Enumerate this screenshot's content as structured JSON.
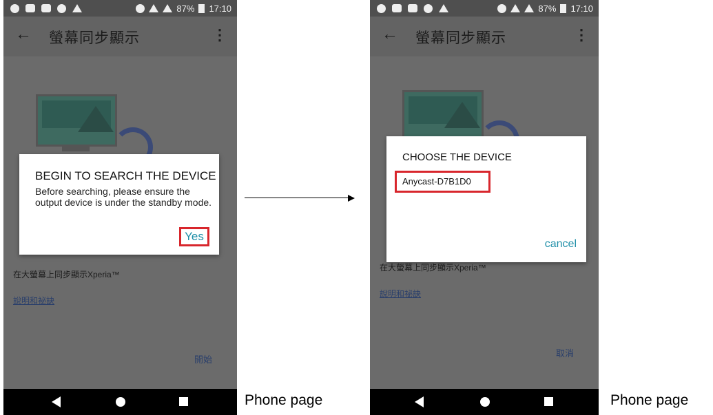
{
  "status_bar": {
    "battery": "87%",
    "time": "17:10"
  },
  "app_bar": {
    "title": "螢幕同步顯示",
    "back_icon": "←",
    "more_icon": "⋮"
  },
  "page": {
    "description": "在大螢幕上同步顯示Xperia™",
    "help_link": "說明和祕訣",
    "start_label": "開始"
  },
  "dialog_search": {
    "title": "BEGIN TO SEARCH THE DEVICE",
    "body": "Before searching, please ensure the output device is under the standby mode.",
    "yes_label": "Yes"
  },
  "dialog_device": {
    "title": "CHOOSE THE DEVICE",
    "device_name": "Anycast-D7B1D0",
    "cancel_label": "cancel"
  },
  "cancel_cn_label": "取消",
  "caption": "Phone page",
  "highlight_color": "#d8262c",
  "accent_color": "#1f8fa8"
}
